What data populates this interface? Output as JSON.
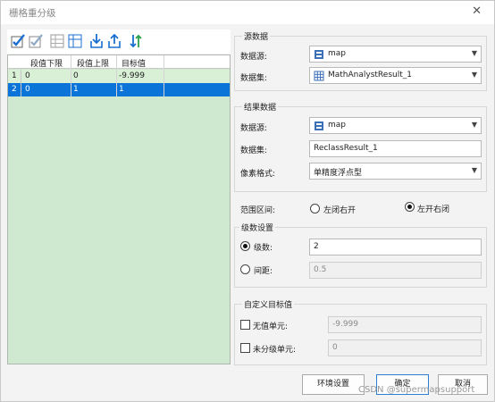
{
  "window": {
    "title": "栅格重分级",
    "close_glyph": "✕"
  },
  "toolbar": {
    "icons": [
      "select-all-icon",
      "select-invert-icon",
      "grid-table-icon",
      "grid-table-alt-icon",
      "import-icon",
      "export-icon",
      "reverse-sort-icon"
    ]
  },
  "table": {
    "headers": [
      "段值下限",
      "段值上限",
      "目标值"
    ],
    "rows": [
      {
        "num": "1",
        "low": "0",
        "high": "0",
        "target": "-9.999"
      },
      {
        "num": "2",
        "low": "0",
        "high": "1",
        "target": "1"
      }
    ]
  },
  "source": {
    "group_label": "源数据",
    "datasource_label": "数据源:",
    "datasource_value": "map",
    "dataset_label": "数据集:",
    "dataset_value": "MathAnalystResult_1"
  },
  "result": {
    "group_label": "结果数据",
    "datasource_label": "数据源:",
    "datasource_value": "map",
    "dataset_label": "数据集:",
    "dataset_value": "ReclassResult_1",
    "pixel_label": "像素格式:",
    "pixel_value": "单精度浮点型"
  },
  "range": {
    "label": "范围区间:",
    "opt_left": "左闭右开",
    "opt_right": "左开右闭",
    "selected": "opt_right"
  },
  "levels": {
    "group_label": "级数设置",
    "count_label": "级数:",
    "count_value": "2",
    "interval_label": "间距:",
    "interval_value": "0.5",
    "selected": "count"
  },
  "custom": {
    "group_label": "自定义目标值",
    "nodata_label": "无值单元:",
    "nodata_value": "-9.999",
    "unclassed_label": "未分级单元:",
    "unclassed_value": "0"
  },
  "buttons": {
    "env": "环境设置",
    "ok": "确定",
    "cancel": "取消"
  },
  "watermark": "CSDN @supermapsupport",
  "colors": {
    "selection": "#0a74d8",
    "grid_bg": "#cfe8d0",
    "row_bg": "#d9f0d7",
    "icon_blue": "#1a6fd1"
  }
}
